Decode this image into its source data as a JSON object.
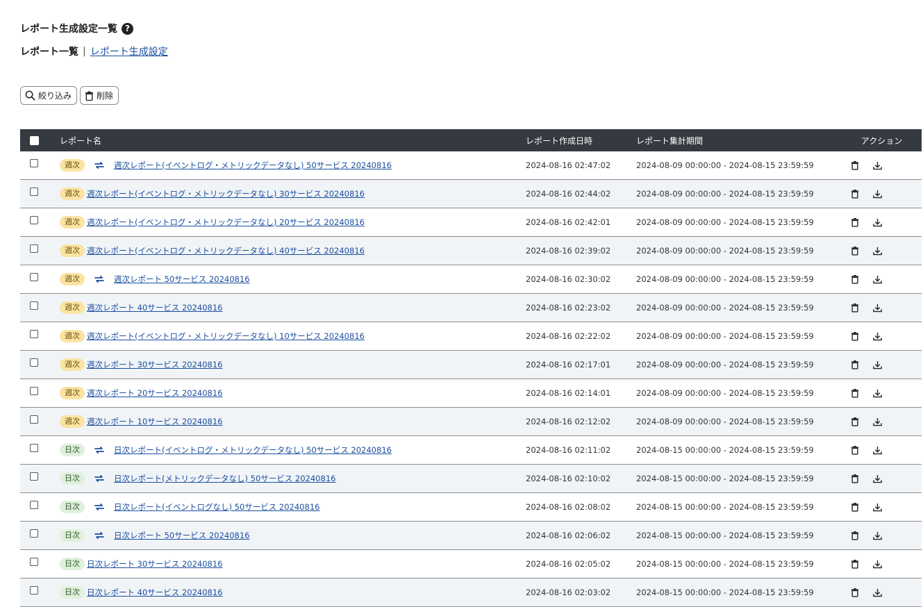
{
  "page": {
    "title": "レポート生成設定一覧",
    "help_icon": "question-circle-icon"
  },
  "subnav": {
    "current": "レポート一覧",
    "separator": "|",
    "link": "レポート生成設定"
  },
  "toolbar": {
    "filter_label": "絞り込み",
    "delete_label": "削除"
  },
  "table": {
    "headers": {
      "name": "レポート名",
      "created": "レポート作成日時",
      "period": "レポート集計期間",
      "action": "アクション"
    },
    "rows": [
      {
        "badge": "週次",
        "type": "weekly",
        "repeat": true,
        "name": "週次レポート(イベントログ・メトリックデータなし) 50サービス 20240816",
        "created": "2024-08-16 02:47:02",
        "period": "2024-08-09 00:00:00 - 2024-08-15 23:59:59"
      },
      {
        "badge": "週次",
        "type": "weekly",
        "repeat": false,
        "name": "週次レポート(イベントログ・メトリックデータなし) 30サービス 20240816",
        "created": "2024-08-16 02:44:02",
        "period": "2024-08-09 00:00:00 - 2024-08-15 23:59:59"
      },
      {
        "badge": "週次",
        "type": "weekly",
        "repeat": false,
        "name": "週次レポート(イベントログ・メトリックデータなし) 20サービス 20240816",
        "created": "2024-08-16 02:42:01",
        "period": "2024-08-09 00:00:00 - 2024-08-15 23:59:59"
      },
      {
        "badge": "週次",
        "type": "weekly",
        "repeat": false,
        "name": "週次レポート(イベントログ・メトリックデータなし) 40サービス 20240816",
        "created": "2024-08-16 02:39:02",
        "period": "2024-08-09 00:00:00 - 2024-08-15 23:59:59"
      },
      {
        "badge": "週次",
        "type": "weekly",
        "repeat": true,
        "name": "週次レポート 50サービス 20240816",
        "created": "2024-08-16 02:30:02",
        "period": "2024-08-09 00:00:00 - 2024-08-15 23:59:59"
      },
      {
        "badge": "週次",
        "type": "weekly",
        "repeat": false,
        "name": "週次レポート 40サービス 20240816",
        "created": "2024-08-16 02:23:02",
        "period": "2024-08-09 00:00:00 - 2024-08-15 23:59:59"
      },
      {
        "badge": "週次",
        "type": "weekly",
        "repeat": false,
        "name": "週次レポート(イベントログ・メトリックデータなし) 10サービス 20240816",
        "created": "2024-08-16 02:22:02",
        "period": "2024-08-09 00:00:00 - 2024-08-15 23:59:59"
      },
      {
        "badge": "週次",
        "type": "weekly",
        "repeat": false,
        "name": "週次レポート 30サービス 20240816",
        "created": "2024-08-16 02:17:01",
        "period": "2024-08-09 00:00:00 - 2024-08-15 23:59:59"
      },
      {
        "badge": "週次",
        "type": "weekly",
        "repeat": false,
        "name": "週次レポート 20サービス 20240816",
        "created": "2024-08-16 02:14:01",
        "period": "2024-08-09 00:00:00 - 2024-08-15 23:59:59"
      },
      {
        "badge": "週次",
        "type": "weekly",
        "repeat": false,
        "name": "週次レポート 10サービス 20240816",
        "created": "2024-08-16 02:12:02",
        "period": "2024-08-09 00:00:00 - 2024-08-15 23:59:59"
      },
      {
        "badge": "日次",
        "type": "daily",
        "repeat": true,
        "name": "日次レポート(イベントログ・メトリックデータなし) 50サービス 20240816",
        "created": "2024-08-16 02:11:02",
        "period": "2024-08-15 00:00:00 - 2024-08-15 23:59:59"
      },
      {
        "badge": "日次",
        "type": "daily",
        "repeat": true,
        "name": "日次レポート(メトリックデータなし) 50サービス 20240816",
        "created": "2024-08-16 02:10:02",
        "period": "2024-08-15 00:00:00 - 2024-08-15 23:59:59"
      },
      {
        "badge": "日次",
        "type": "daily",
        "repeat": true,
        "name": "日次レポート(イベントログなし) 50サービス 20240816",
        "created": "2024-08-16 02:08:02",
        "period": "2024-08-15 00:00:00 - 2024-08-15 23:59:59"
      },
      {
        "badge": "日次",
        "type": "daily",
        "repeat": true,
        "name": "日次レポート 50サービス 20240816",
        "created": "2024-08-16 02:06:02",
        "period": "2024-08-15 00:00:00 - 2024-08-15 23:59:59"
      },
      {
        "badge": "日次",
        "type": "daily",
        "repeat": false,
        "name": "日次レポート 30サービス 20240816",
        "created": "2024-08-16 02:05:02",
        "period": "2024-08-15 00:00:00 - 2024-08-15 23:59:59"
      },
      {
        "badge": "日次",
        "type": "daily",
        "repeat": false,
        "name": "日次レポート 40サービス 20240816",
        "created": "2024-08-16 02:03:02",
        "period": "2024-08-15 00:00:00 - 2024-08-15 23:59:59"
      }
    ]
  },
  "icons": {
    "filter": "search-icon",
    "delete": "trash-icon",
    "repeat": "repeat-icon",
    "download": "download-icon"
  },
  "colors": {
    "header_bg": "#343a40",
    "link": "#1a4ea0",
    "weekly_badge": "#fbe3a4",
    "daily_badge": "#dff0dc",
    "row_stripe": "#f1f4f7"
  }
}
